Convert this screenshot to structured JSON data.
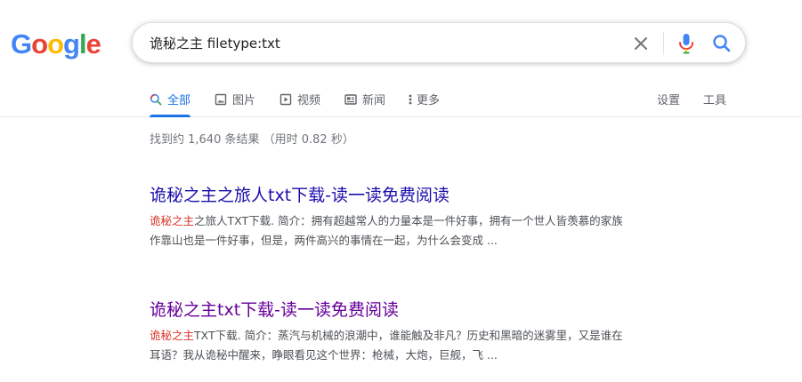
{
  "logo": {
    "letters": [
      "G",
      "o",
      "o",
      "g",
      "l",
      "e"
    ],
    "colors": [
      "#4285f4",
      "#ea4335",
      "#fbbc05",
      "#4285f4",
      "#34a853",
      "#ea4335"
    ]
  },
  "search": {
    "query": "诡秘之主 filetype:txt"
  },
  "tabs": [
    {
      "label": "全部",
      "icon": "search-icon"
    },
    {
      "label": "图片",
      "icon": "image-icon"
    },
    {
      "label": "视频",
      "icon": "video-icon"
    },
    {
      "label": "新闻",
      "icon": "news-icon"
    },
    {
      "label": "更多",
      "icon": "more-vert-icon"
    }
  ],
  "tools": {
    "settings": "设置",
    "tools": "工具"
  },
  "stats": "找到约 1,640 条结果 （用时 0.82 秒）",
  "results": [
    {
      "title": "诡秘之主之旅人txt下载-读一读免费阅读",
      "snippet_highlight": "诡秘之主",
      "snippet_line1": "之旅人TXT下载. 简介：拥有超越常人的力量本是一件好事，拥有一个世人皆羡慕的家族",
      "snippet_line2": "作靠山也是一件好事，但是，两件高兴的事情在一起，为什么会变成 ..."
    },
    {
      "title": "诡秘之主txt下载-读一读免费阅读",
      "snippet_highlight": "诡秘之主",
      "snippet_line1": "TXT下载. 简介：蒸汽与机械的浪潮中，谁能触及非凡？历史和黑暗的迷雾里，又是谁在",
      "snippet_line2": "耳语？我从诡秘中醒来，睁眼看见这个世界：枪械，大炮，巨舰，飞 ..."
    }
  ],
  "colors": {
    "accent": "#1a73e8",
    "link": "#1a0dab",
    "visited": "#660099",
    "highlight": "#d93025"
  }
}
